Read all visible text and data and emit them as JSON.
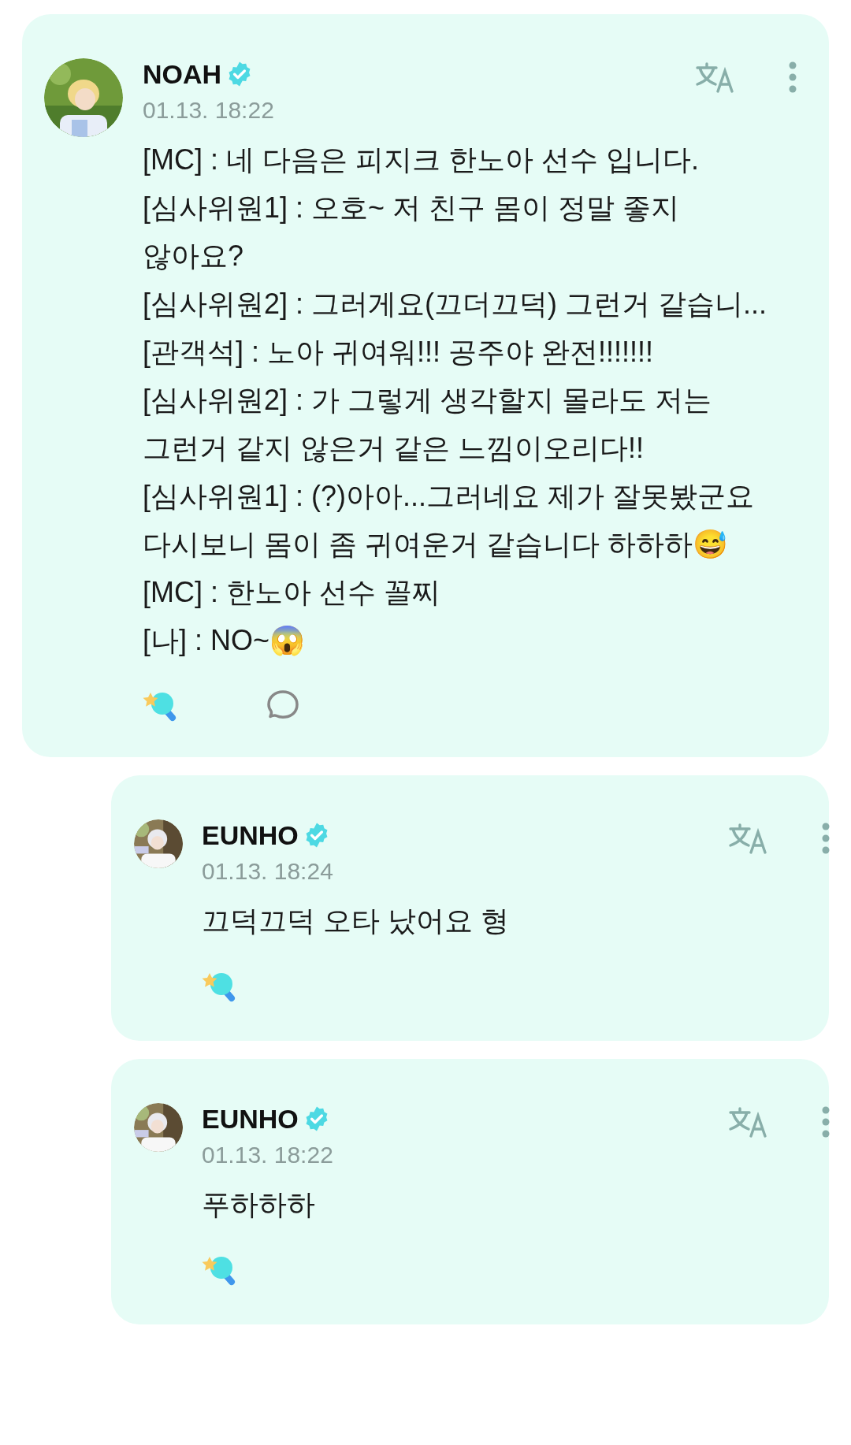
{
  "posts": [
    {
      "kind": "post",
      "author": "NOAH",
      "verified": true,
      "time": "01.13. 18:22",
      "body": [
        "[MC] : 네 다음은 피지크 한노아 선수 입니다.",
        "[심사위원1] : 오호~ 저 친구 몸이 정말 좋지 않아요?",
        "[심사위원2] : 그러게요(끄더끄덕) 그런거 같습니...",
        "[관객석] : 노아 귀여워!!! 공주야 완전!!!!!!!",
        "[심사위원2] : 가 그렇게 생각할지 몰라도 저는 그런거 같지 않은거 같은 느낌이오리다!!",
        "[심사위원1] : (?)아아...그러네요 제가 잘못봤군요 다시보니 몸이 좀 귀여운거 같습니다 하하하😅",
        "[MC] : 한노아 선수 꼴찌",
        "[나] : NO~😱"
      ],
      "actions": [
        {
          "kind": "reaction"
        },
        {
          "kind": "comment"
        }
      ]
    },
    {
      "kind": "reply",
      "author": "EUNHO",
      "verified": true,
      "time": "01.13. 18:24",
      "body": [
        "끄덕끄덕 오타 났어요 형"
      ],
      "actions": [
        {
          "kind": "reaction"
        }
      ]
    },
    {
      "kind": "reply",
      "author": "EUNHO",
      "verified": true,
      "time": "01.13. 18:22",
      "body": [
        "푸하하하"
      ],
      "actions": [
        {
          "kind": "reaction"
        }
      ]
    }
  ]
}
